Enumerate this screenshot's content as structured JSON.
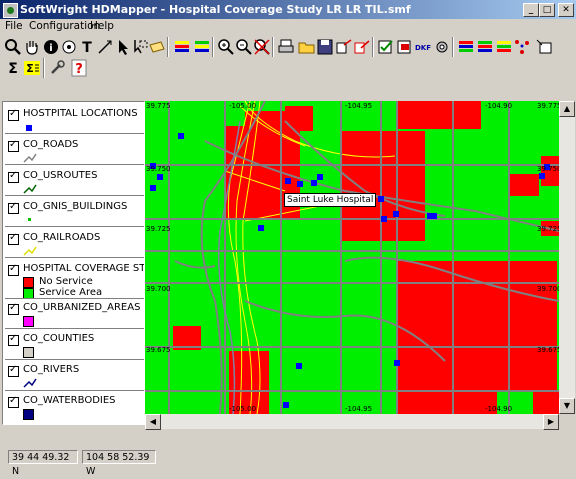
{
  "window": {
    "title": "SoftWright HDMapper - Hospital Coverage Study LR LR TIL.smf"
  },
  "menu": [
    "File",
    "Configuration",
    "Help"
  ],
  "toolbar1_icons": [
    "zoom-icon",
    "hand-pan-icon",
    "info-icon",
    "text-icon",
    "line-icon",
    "resize-icon",
    "select-arrow-icon",
    "select-rect-icon",
    "layer-icon",
    "layers-a-icon",
    "layers-b-icon",
    "zoom-in-icon",
    "zoom-out-icon",
    "zoom-cancel-icon",
    "print-icon",
    "open-folder-icon",
    "save-icon",
    "export-icon",
    "export-red-icon",
    "check-icon",
    "import-icon",
    "dkf-icon",
    "gear-icon",
    "layers-c-icon",
    "layers-d-icon",
    "layers-e-icon",
    "nodes-icon",
    "window-icon"
  ],
  "toolbar2_icons": [
    "sigma-icon",
    "sigma-list-icon",
    "wrench-icon",
    "help-icon"
  ],
  "dkf_label": "DKF",
  "legend": {
    "layers": [
      {
        "name": "HOSTPITAL LOCATIONS",
        "symbol": "square-blue"
      },
      {
        "name": "CO_ROADS",
        "symbol": "line-gray"
      },
      {
        "name": "CO_USROUTES",
        "symbol": "line-green"
      },
      {
        "name": "CO_GNIS_BUILDINGS",
        "symbol": "dot-green"
      },
      {
        "name": "CO_RAILROADS",
        "symbol": "line-yellow"
      },
      {
        "name": "HOSPITAL COVERAGE STUDY",
        "symbol": "classes"
      },
      {
        "name": "CO_URBANIZED_AREAS",
        "symbol": "box-magenta"
      },
      {
        "name": "CO_COUNTIES",
        "symbol": "box-gray"
      },
      {
        "name": "CO_RIVERS",
        "symbol": "line-blue"
      },
      {
        "name": "CO_WATERBODIES",
        "symbol": "box-navy"
      }
    ],
    "coverage_classes": [
      {
        "label": "No Service",
        "color": "#ff0000"
      },
      {
        "label": "Service Area",
        "color": "#00ee00"
      }
    ]
  },
  "map": {
    "tooltip": "Saint Luke Hospital",
    "lat_labels": [
      "39.775",
      "39.750",
      "39.725",
      "39.700",
      "39.675"
    ],
    "lon_labels_top": [
      "-105.00",
      "-104.95",
      "-104.90"
    ],
    "lon_labels_bottom": [
      "-105.00",
      "-104.95",
      "-104.90"
    ],
    "colors": {
      "no_service": "#ff0000",
      "service": "#00ee00",
      "roads": "#808080",
      "rail": "#ffff00",
      "hospital": "#0000ff"
    }
  },
  "status": {
    "lat": "39 44 49.32 N",
    "lon": "104 58 52.39 W"
  }
}
